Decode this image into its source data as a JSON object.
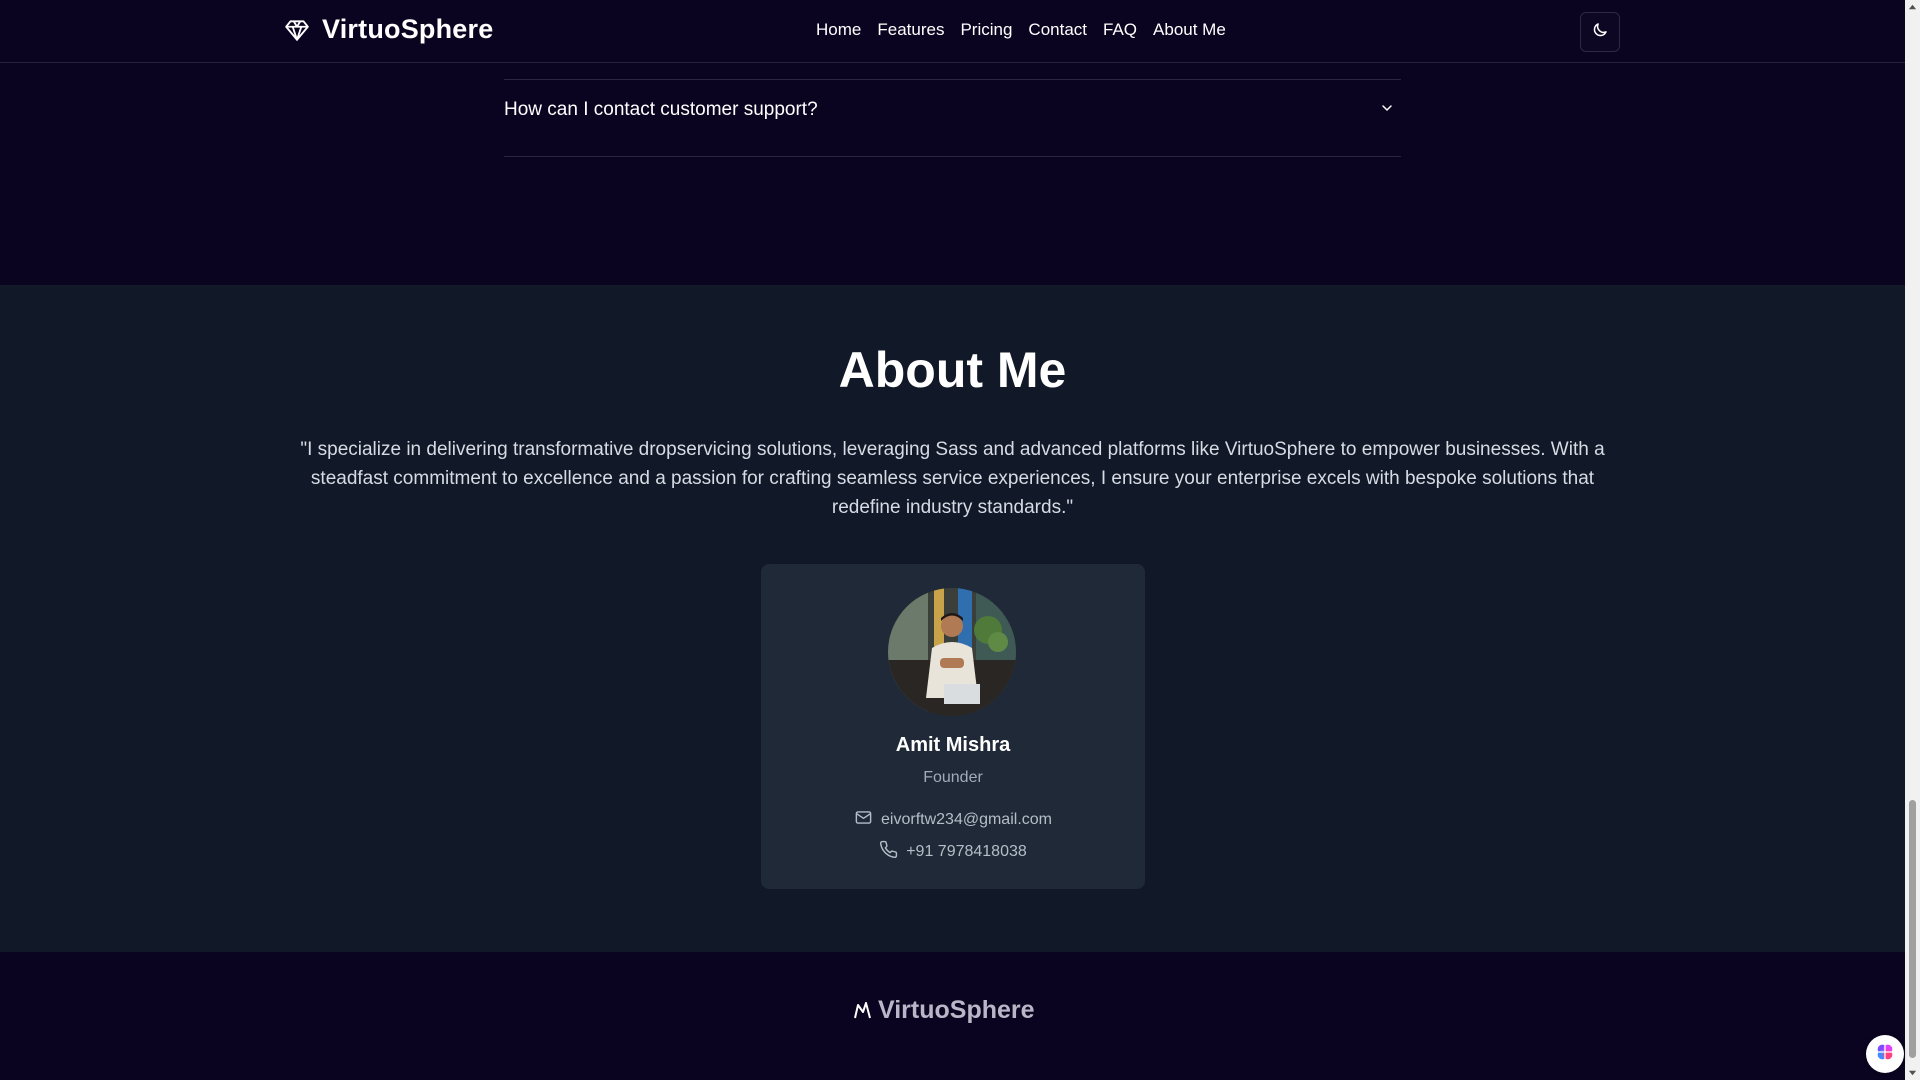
{
  "navbar": {
    "brand_name": "VirtuoSphere",
    "brand_icon": "diamond-icon",
    "links": [
      "Home",
      "Features",
      "Pricing",
      "Contact",
      "FAQ",
      "About Me"
    ],
    "theme_toggle_icon": "moon-icon"
  },
  "faq": {
    "question": "How can I contact customer support?",
    "chevron_icon": "chevron-down-icon"
  },
  "about": {
    "title": "About Me",
    "quote": "\"I specialize in delivering transformative dropservicing solutions, leveraging Sass and advanced platforms like VirtuoSphere to empower businesses. With a steadfast commitment to excellence and a passion for crafting seamless service experiences, I ensure your enterprise excels with bespoke solutions that redefine industry standards.\"",
    "profile": {
      "name": "Amit Mishra",
      "role": "Founder",
      "email": "eivorftw234@gmail.com",
      "phone": "+91 7978418038",
      "email_icon": "mail-icon",
      "phone_icon": "phone-icon"
    }
  },
  "footer": {
    "brand_name": "VirtuoSphere",
    "logo_icon": "crown-logo-icon"
  },
  "colors": {
    "space_background": "#0b0420",
    "about_background": "#111827",
    "card_background": "#1f2937",
    "text_primary": "#ffffff",
    "text_muted": "#a3abb8"
  }
}
